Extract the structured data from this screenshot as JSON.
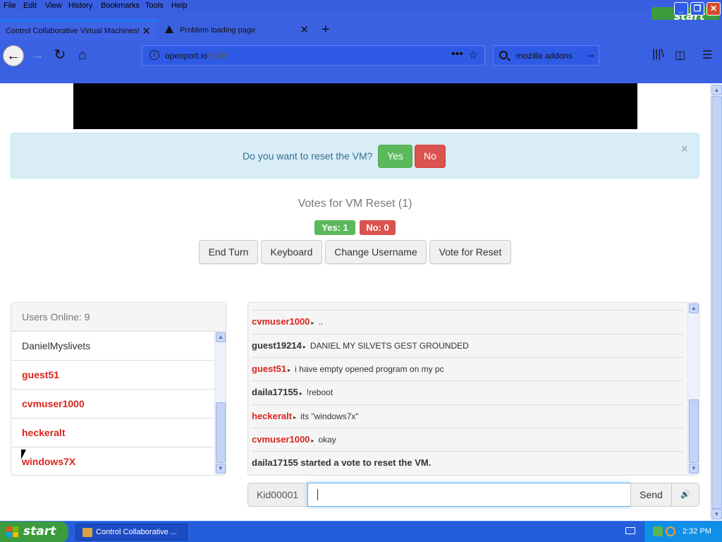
{
  "menubar": {
    "items": [
      {
        "label": "File"
      },
      {
        "label": "Edit"
      },
      {
        "label": "View"
      },
      {
        "label": "History"
      },
      {
        "label": "Bookmarks"
      },
      {
        "label": "Tools"
      },
      {
        "label": "Help"
      }
    ],
    "start_label": "start"
  },
  "tabs": [
    {
      "title": "Control Collaborative Virtual Machines!",
      "active": true
    },
    {
      "title": "Problem loading page",
      "active": false
    }
  ],
  "navbar": {
    "url_host": "openport.io",
    "url_port": ":9566",
    "search_text": "mozilla addons"
  },
  "alert": {
    "question": "Do you want to reset the VM?",
    "yes_label": "Yes",
    "no_label": "No",
    "close_label": "×"
  },
  "votes": {
    "title": "Votes for VM Reset (1)",
    "yes_badge": "Yes: 1",
    "no_badge": "No: 0"
  },
  "controls": {
    "end_turn": "End Turn",
    "keyboard": "Keyboard",
    "change_username": "Change Username",
    "vote_reset": "Vote for Reset"
  },
  "users_panel": {
    "header": "Users Online: 9",
    "users": [
      {
        "name": "DanielMyslivets",
        "style": "plain"
      },
      {
        "name": "guest51",
        "style": "red"
      },
      {
        "name": "cvmuser1000",
        "style": "red"
      },
      {
        "name": "heckeralt",
        "style": "red"
      },
      {
        "name": "windows7X",
        "style": "red"
      }
    ]
  },
  "chat": {
    "messages": [
      {
        "user": "cvmuser1000",
        "color": "red",
        "text": ".."
      },
      {
        "user": "guest19214",
        "color": "dark",
        "text": "DANIEL MY SILVETS GEST GROUNDED"
      },
      {
        "user": "guest51",
        "color": "red",
        "text": "i have empty opened program on my pc"
      },
      {
        "user": "daila17155",
        "color": "dark",
        "text": "!reboot"
      },
      {
        "user": "heckeralt",
        "color": "red",
        "text": "its \"windows7x\""
      },
      {
        "user": "cvmuser1000",
        "color": "red",
        "text": "okay"
      }
    ],
    "system_message": "daila17155 started a vote to reset the VM.",
    "username": "Kid00001",
    "input_value": "",
    "send_label": "Send"
  },
  "taskbar": {
    "start_label": "start",
    "window_item": "Control Collaborative ...",
    "clock": "2:32 PM"
  },
  "colors": {
    "firefox_chrome": "#3b61e3",
    "success": "#5cb85c",
    "danger": "#d9534f",
    "alert_bg": "#d9edf7",
    "username_red": "#d9251d",
    "xp_taskbar": "#245edb",
    "xp_start": "#3c9b3c"
  }
}
